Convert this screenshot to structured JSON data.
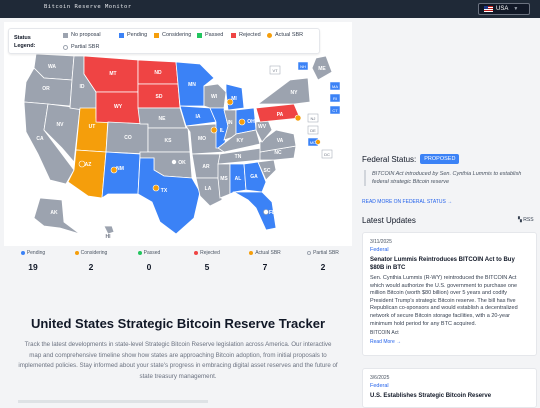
{
  "header": {
    "site_title": "Bitcoin Reserve Monitor",
    "country_label": "USA"
  },
  "legend": {
    "title_line1": "Status",
    "title_line2": "Legend:",
    "items": [
      {
        "label": "No proposal",
        "color": "#9ca3af"
      },
      {
        "label": "Pending",
        "color": "#3b82f6"
      },
      {
        "label": "Considering",
        "color": "#f59e0b"
      },
      {
        "label": "Passed",
        "color": "#22c55e"
      },
      {
        "label": "Rejected",
        "color": "#ef4444"
      },
      {
        "label": "Actual SBR",
        "color": "#f59e0b"
      },
      {
        "label": "Partial SBR",
        "color": "#ffffff"
      }
    ]
  },
  "map": {
    "states": [
      "MT",
      "ND",
      "SD",
      "WY",
      "NE",
      "KS",
      "OK",
      "TX",
      "NM",
      "AZ",
      "UT",
      "CO",
      "NV",
      "CA",
      "OR",
      "WA",
      "ID",
      "MN",
      "IA",
      "MO",
      "AR",
      "LA",
      "WI",
      "IL",
      "MI",
      "IN",
      "OH",
      "KY",
      "TN",
      "MS",
      "AL",
      "GA",
      "FL",
      "SC",
      "NC",
      "VA",
      "WV",
      "PA",
      "NY",
      "ME",
      "VT",
      "NH",
      "MA",
      "RI",
      "CT",
      "NJ",
      "DE",
      "MD",
      "DC",
      "AK",
      "HI"
    ],
    "small_state_boxes": [
      "VT",
      "NH",
      "MA",
      "RI",
      "CT",
      "NJ",
      "DE",
      "MD",
      "DC"
    ]
  },
  "stats": [
    {
      "label": "Pending",
      "value": "19",
      "color": "#3b82f6"
    },
    {
      "label": "Considering",
      "value": "2",
      "color": "#f59e0b"
    },
    {
      "label": "Passed",
      "value": "0",
      "color": "#22c55e"
    },
    {
      "label": "Rejected",
      "value": "5",
      "color": "#ef4444"
    },
    {
      "label": "Actual SBR",
      "value": "7",
      "color": "#f59e0b"
    },
    {
      "label": "Partial SBR",
      "value": "2",
      "color": "#ffffff"
    }
  ],
  "hero": {
    "title": "United States Strategic Bitcoin Reserve Tracker",
    "text": "Track the latest developments in state-level Strategic Bitcoin Reserve legislation across America. Our interactive map and comprehensive timeline show how states are approaching Bitcoin adoption, from initial proposals to implemented policies. Stay informed about your state's progress in embracing digital asset reserves and the future of state treasury management."
  },
  "federal": {
    "label": "Federal Status:",
    "badge": "PROPOSED",
    "note": "BITCOIN Act introduced by Sen. Cynthia Lummis to establish federal strategic Bitcoin reserve",
    "read_more": "READ MORE ON FEDERAL STATUS →"
  },
  "updates": {
    "title": "Latest Updates",
    "rss": "RSS",
    "items": [
      {
        "date": "3/11/2025",
        "category": "Federal",
        "title": "Senator Lummis Reintroduces BITCOIN Act to Buy $80B in BTC",
        "body": "Sen. Cynthia Lummis (R-WY) reintroduced the BITCOIN Act which would authorize the U.S. government to purchase one million Bitcoin (worth $80 billion) over 5 years and codify President Trump's strategic Bitcoin reserve. The bill has five Republican co-sponsors and would establish a decentralized network of secure Bitcoin storage facilities, with a 20-year minimum hold period for any BTC acquired.",
        "source": "BITCOIN Act",
        "link": "Read More →"
      },
      {
        "date": "3/6/2025",
        "category": "Federal",
        "title": "U.S. Establishes Strategic Bitcoin Reserve"
      }
    ]
  }
}
